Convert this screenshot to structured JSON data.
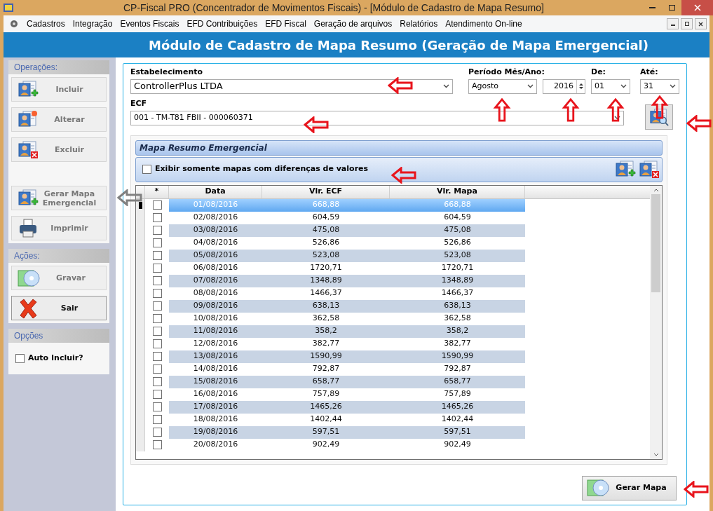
{
  "window": {
    "title": "CP-Fiscal PRO (Concentrador de Movimentos Fiscais) - [Módulo de Cadastro de Mapa Resumo]"
  },
  "menu": [
    "Cadastros",
    "Integração",
    "Eventos Fiscais",
    "EFD Contribuições",
    "EFD Fiscal",
    "Geração de arquivos",
    "Relatórios",
    "Atendimento On-line"
  ],
  "header": "Módulo de Cadastro de Mapa Resumo (Geração de Mapa Emergencial)",
  "sidebar": {
    "sections": [
      {
        "title": "Operações:",
        "buttons": [
          {
            "label": "Incluir",
            "kind": "add",
            "disabled": true
          },
          {
            "label": "Alterar",
            "kind": "edit",
            "disabled": true
          },
          {
            "label": "Excluir",
            "kind": "delete",
            "disabled": true
          },
          {
            "label": "Gerar Mapa Emergencial",
            "kind": "add",
            "disabled": true,
            "gap": true
          },
          {
            "label": "Imprimir",
            "kind": "print",
            "disabled": true
          }
        ]
      },
      {
        "title": "Ações:",
        "buttons": [
          {
            "label": "Gravar",
            "kind": "save",
            "disabled": true
          },
          {
            "label": "Sair",
            "kind": "exit",
            "disabled": false
          }
        ]
      },
      {
        "title": "Opções",
        "checkbox": {
          "label": "Auto Incluir?",
          "checked": false
        }
      }
    ]
  },
  "form": {
    "establishment_label": "Estabelecimento",
    "establishment": "ControllerPlus LTDA",
    "period_label": "Período Mês/Ano:",
    "month": "Agosto",
    "year": "2016",
    "from_label": "De:",
    "from": "01",
    "to_label": "Até:",
    "to": "31",
    "ecf_label": "ECF",
    "ecf": "001 - TM-T81 FBII - 000060371"
  },
  "grid": {
    "title": "Mapa Resumo Emergencial",
    "filter": {
      "label": "Exibir somente mapas com diferenças de valores",
      "checked": false
    },
    "columns": [
      "*",
      "Data",
      "Vlr. ECF",
      "Vlr. Mapa"
    ],
    "rows": [
      {
        "date": "01/08/2016",
        "ecf": "668,88",
        "mapa": "668,88",
        "checked": false,
        "selected": true
      },
      {
        "date": "02/08/2016",
        "ecf": "604,59",
        "mapa": "604,59",
        "checked": false,
        "selected": false
      },
      {
        "date": "03/08/2016",
        "ecf": "475,08",
        "mapa": "475,08",
        "checked": false,
        "selected": false
      },
      {
        "date": "04/08/2016",
        "ecf": "526,86",
        "mapa": "526,86",
        "checked": false,
        "selected": false
      },
      {
        "date": "05/08/2016",
        "ecf": "523,08",
        "mapa": "523,08",
        "checked": false,
        "selected": false
      },
      {
        "date": "06/08/2016",
        "ecf": "1720,71",
        "mapa": "1720,71",
        "checked": false,
        "selected": false
      },
      {
        "date": "07/08/2016",
        "ecf": "1348,89",
        "mapa": "1348,89",
        "checked": false,
        "selected": false
      },
      {
        "date": "08/08/2016",
        "ecf": "1466,37",
        "mapa": "1466,37",
        "checked": false,
        "selected": false
      },
      {
        "date": "09/08/2016",
        "ecf": "638,13",
        "mapa": "638,13",
        "checked": false,
        "selected": false
      },
      {
        "date": "10/08/2016",
        "ecf": "362,58",
        "mapa": "362,58",
        "checked": false,
        "selected": false
      },
      {
        "date": "11/08/2016",
        "ecf": "358,2",
        "mapa": "358,2",
        "checked": false,
        "selected": false
      },
      {
        "date": "12/08/2016",
        "ecf": "382,77",
        "mapa": "382,77",
        "checked": false,
        "selected": false
      },
      {
        "date": "13/08/2016",
        "ecf": "1590,99",
        "mapa": "1590,99",
        "checked": false,
        "selected": false
      },
      {
        "date": "14/08/2016",
        "ecf": "792,87",
        "mapa": "792,87",
        "checked": false,
        "selected": false
      },
      {
        "date": "15/08/2016",
        "ecf": "658,77",
        "mapa": "658,77",
        "checked": false,
        "selected": false
      },
      {
        "date": "16/08/2016",
        "ecf": "757,89",
        "mapa": "757,89",
        "checked": false,
        "selected": false
      },
      {
        "date": "17/08/2016",
        "ecf": "1465,26",
        "mapa": "1465,26",
        "checked": false,
        "selected": false
      },
      {
        "date": "18/08/2016",
        "ecf": "1402,44",
        "mapa": "1402,44",
        "checked": false,
        "selected": false
      },
      {
        "date": "19/08/2016",
        "ecf": "597,51",
        "mapa": "597,51",
        "checked": false,
        "selected": false
      },
      {
        "date": "20/08/2016",
        "ecf": "902,49",
        "mapa": "902,49",
        "checked": false,
        "selected": false
      }
    ]
  },
  "generate_button": "Gerar Mapa"
}
